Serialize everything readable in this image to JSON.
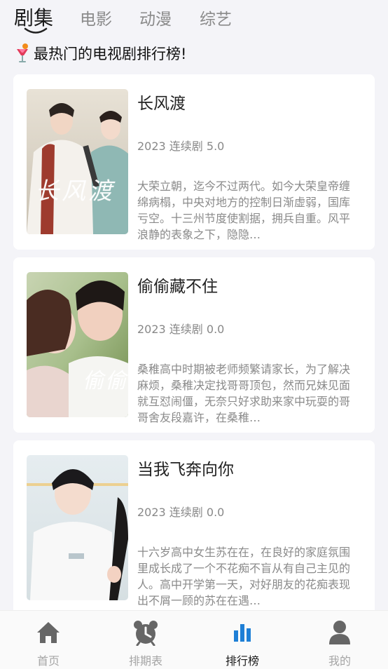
{
  "tabs": [
    {
      "label": "剧集",
      "active": true
    },
    {
      "label": "电影",
      "active": false
    },
    {
      "label": "动漫",
      "active": false
    },
    {
      "label": "综艺",
      "active": false
    }
  ],
  "heading": {
    "icon": "cocktail-emoji-icon",
    "text": "最热门的电视剧排行榜!"
  },
  "cards": [
    {
      "title": "长风渡",
      "meta": "2023 连续剧 5.0",
      "description": "大荣立朝，迄今不过两代。如今大荣皇帝缠绵病榻，中央对地方的控制日渐虚弱，国库亏空。十三州节度使割据，拥兵自重。风平浪静的表象之下，隐隐…",
      "poster_text": "长风渡"
    },
    {
      "title": "偷偷藏不住",
      "meta": "2023 连续剧 0.0",
      "description": "桑稚高中时期被老师频繁请家长，为了解决麻烦，桑稚决定找哥哥顶包，然而兄妹见面就互怼闹僵，无奈只好求助来家中玩耍的哥哥舍友段嘉许，在桑稚…",
      "poster_text": "偷偷"
    },
    {
      "title": "当我飞奔向你",
      "meta": "2023 连续剧 0.0",
      "description": "十六岁高中女生苏在在，在良好的家庭氛围里成长成了一个不花痴不盲从有自己主见的人。高中开学第一天，对好朋友的花痴表现出不屑一顾的苏在在遇…",
      "poster_text": ""
    }
  ],
  "bottom_nav": [
    {
      "label": "首页",
      "icon": "home-icon",
      "active": false
    },
    {
      "label": "排期表",
      "icon": "alarm-clock-icon",
      "active": false
    },
    {
      "label": "排行榜",
      "icon": "bar-chart-icon",
      "active": true
    },
    {
      "label": "我的",
      "icon": "user-icon",
      "active": false
    }
  ],
  "colors": {
    "accent": "#1e7fd6",
    "inactive": "#a5a5a5",
    "background": "#f4f4f8"
  }
}
